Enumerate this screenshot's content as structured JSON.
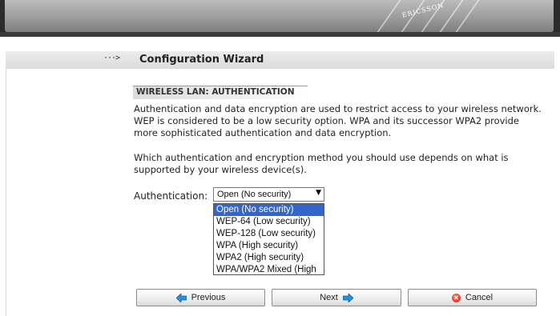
{
  "banner": {
    "brand": "ERICSSON"
  },
  "header": {
    "nav_arrow": "···>",
    "title": "Configuration Wizard"
  },
  "section": {
    "heading": "WIRELESS LAN: AUTHENTICATION",
    "paragraph1": "Authentication and data encryption are used to restrict access to your wireless network. WEP is considered to be a low security option. WPA and its successor WPA2 provide more sophisticated authentication and data encryption.",
    "paragraph2": "Which authentication and encryption method you should use depends on what is supported by your wireless device(s)."
  },
  "form": {
    "auth_label": "Authentication:",
    "auth_value": "Open (No security)",
    "auth_options": [
      "Open (No security)",
      "WEP-64 (Low security)",
      "WEP-128 (Low security)",
      "WPA (High security)",
      "WPA2 (High security)",
      "WPA/WPA2 Mixed (High"
    ],
    "selected_index": 0
  },
  "buttons": {
    "previous": "Previous",
    "next": "Next",
    "cancel": "Cancel"
  },
  "icons": {
    "previous": "arrow-left-icon",
    "next": "arrow-right-icon",
    "cancel": "cancel-icon",
    "dropdown": "chevron-down-icon"
  },
  "colors": {
    "accent": "#3366cc",
    "arrow_icon": "#2a8fd6",
    "cancel_icon": "#d11a0a"
  }
}
